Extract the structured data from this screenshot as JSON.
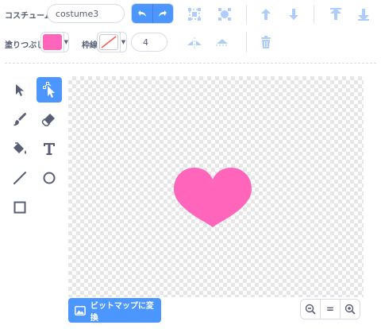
{
  "costume": {
    "label": "コスチューム",
    "name_value": "costume3"
  },
  "fill": {
    "label": "塗りつぶし",
    "color": "#ff66bb"
  },
  "outline": {
    "label": "枠線",
    "width_value": "4"
  },
  "toolbar": {
    "undo_icon": "undo-icon",
    "redo_icon": "redo-icon",
    "group_icon": "group-icon",
    "ungroup_icon": "ungroup-icon",
    "forward_icon": "forward-icon",
    "backward_icon": "backward-icon",
    "front_icon": "front-icon",
    "back_icon": "back-icon",
    "flip_h_icon": "flip-horizontal-icon",
    "flip_v_icon": "flip-vertical-icon",
    "delete_icon": "trash-icon"
  },
  "tools": [
    {
      "name": "select",
      "icon": "arrow-icon"
    },
    {
      "name": "reshape",
      "icon": "reshape-icon",
      "active": true
    },
    {
      "name": "brush",
      "icon": "brush-icon"
    },
    {
      "name": "eraser",
      "icon": "eraser-icon"
    },
    {
      "name": "fill",
      "icon": "fill-icon"
    },
    {
      "name": "text",
      "icon": "text-icon"
    },
    {
      "name": "line",
      "icon": "line-icon"
    },
    {
      "name": "circle",
      "icon": "circle-icon"
    },
    {
      "name": "rectangle",
      "icon": "rectangle-icon"
    }
  ],
  "bitmap_button": {
    "label": "ビットマップに変換"
  },
  "zoom": {
    "reset_label": "="
  },
  "colors": {
    "accent": "#4c97ff",
    "heart": "#ff66bb"
  }
}
